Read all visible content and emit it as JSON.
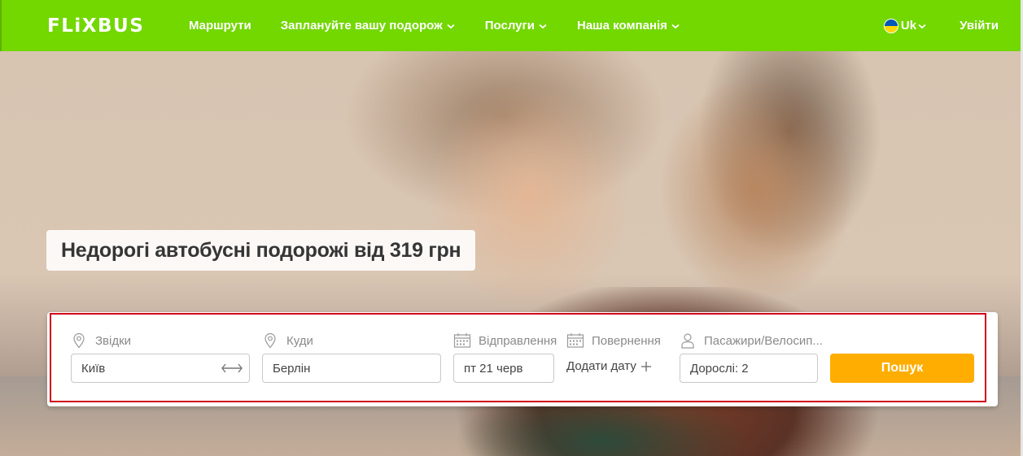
{
  "header": {
    "logo": "FLiXBUS",
    "nav": [
      {
        "label": "Маршрути",
        "dropdown": false
      },
      {
        "label": "Заплануйте вашу подорож",
        "dropdown": true
      },
      {
        "label": "Послуги",
        "dropdown": true
      },
      {
        "label": "Наша компанія",
        "dropdown": true
      }
    ],
    "language": "Uk",
    "login": "Увійти",
    "background_color": "#73d700"
  },
  "hero": {
    "headline": "Недорогі автобусні подорожі від 319 грн"
  },
  "search": {
    "from": {
      "label": "Звідки",
      "value": "Київ",
      "icon": "location-pin-icon"
    },
    "to": {
      "label": "Куди",
      "value": "Берлін",
      "icon": "location-pin-icon"
    },
    "departure": {
      "label": "Відправлення",
      "value": "пт 21 черв",
      "icon": "calendar-icon"
    },
    "return": {
      "label": "Повернення",
      "add_date": "Додати дату",
      "icon": "calendar-icon"
    },
    "passengers": {
      "label": "Пасажири/Велосип...",
      "value": "Дорослі: 2",
      "icon": "person-icon"
    },
    "button": "Пошук",
    "button_color": "#ffad00"
  }
}
